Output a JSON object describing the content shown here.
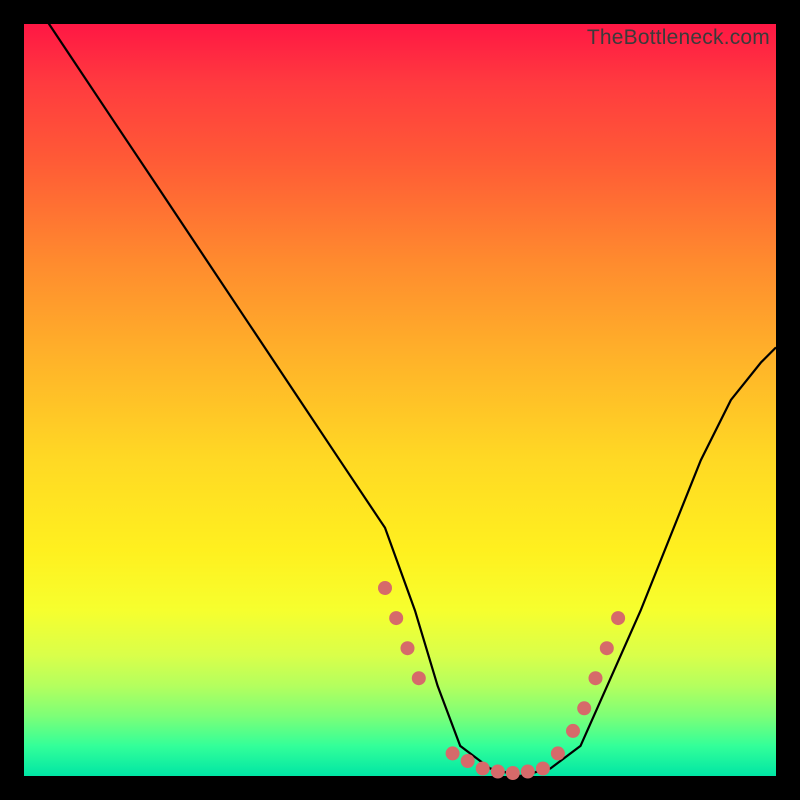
{
  "watermark": "TheBottleneck.com",
  "chart_data": {
    "type": "line",
    "title": "",
    "xlabel": "",
    "ylabel": "",
    "xlim": [
      0,
      100
    ],
    "ylim": [
      0,
      100
    ],
    "series": [
      {
        "name": "bottleneck-curve",
        "x": [
          0,
          6,
          12,
          18,
          24,
          30,
          36,
          42,
          48,
          52,
          55,
          58,
          62,
          66,
          70,
          74,
          78,
          82,
          86,
          90,
          94,
          98,
          100
        ],
        "values": [
          105,
          96,
          87,
          78,
          69,
          60,
          51,
          42,
          33,
          22,
          12,
          4,
          1,
          0,
          1,
          4,
          13,
          22,
          32,
          42,
          50,
          55,
          57
        ]
      }
    ],
    "markers": {
      "name": "highlight-dots",
      "x": [
        48,
        49.5,
        51,
        52.5,
        57,
        59,
        61,
        63,
        65,
        67,
        69,
        71,
        73,
        74.5,
        76,
        77.5,
        79
      ],
      "values": [
        25,
        21,
        17,
        13,
        3,
        2,
        1,
        0.6,
        0.4,
        0.6,
        1,
        3,
        6,
        9,
        13,
        17,
        21
      ]
    },
    "colors": {
      "curve": "#000000",
      "markers": "#d66a6a",
      "gradient_top": "#ff1744",
      "gradient_bottom": "#00e6a5"
    }
  }
}
